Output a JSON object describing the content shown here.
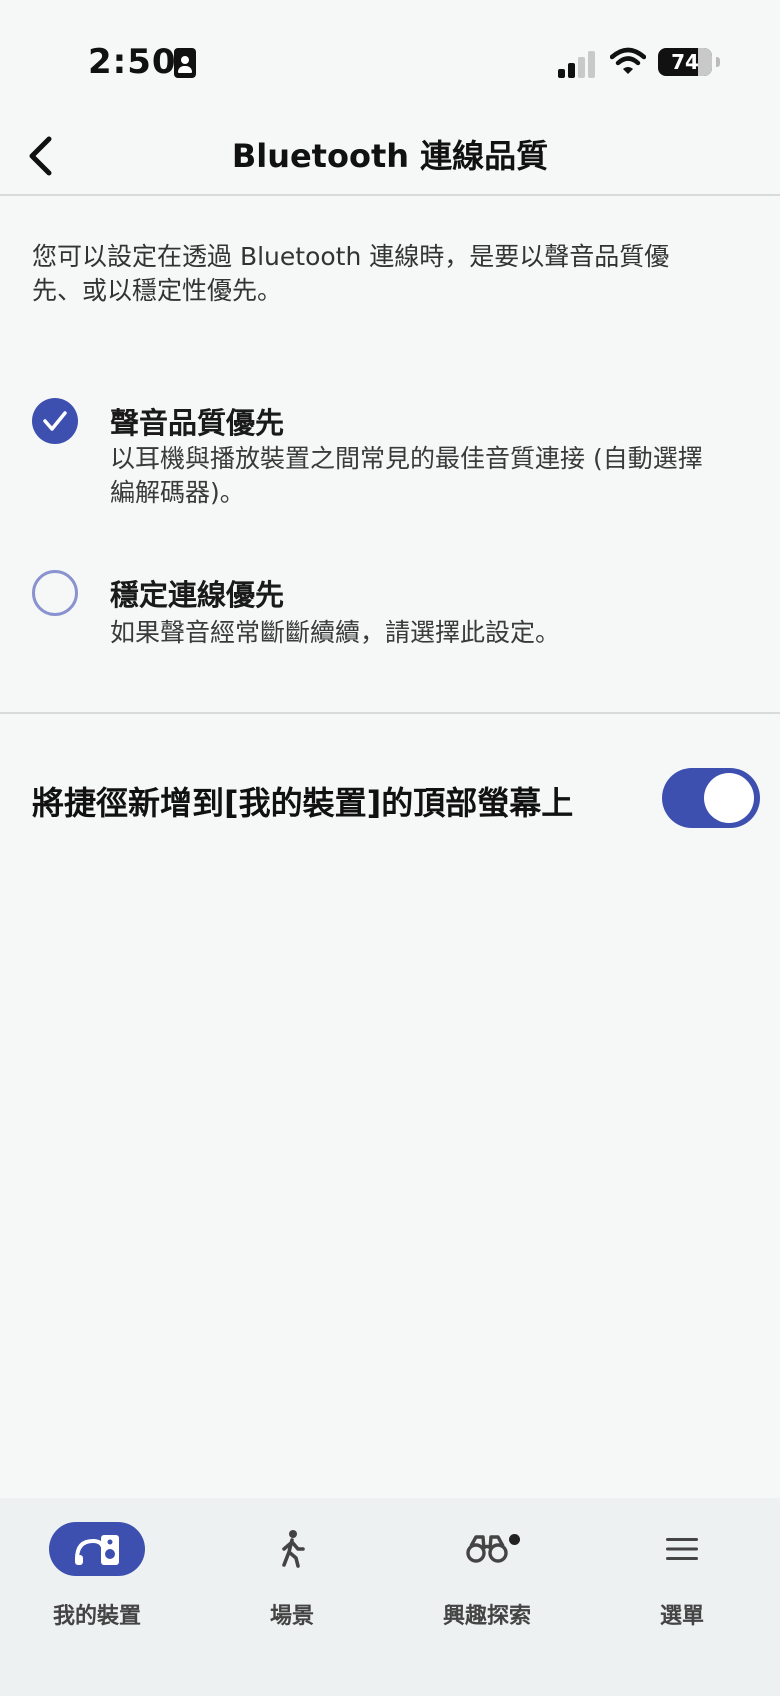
{
  "status_bar": {
    "time": "2:50",
    "battery_level": "74"
  },
  "nav": {
    "title": "Bluetooth 連線品質"
  },
  "description": "您可以設定在透過 Bluetooth 連線時，是要以聲音品質優先、或以穩定性優先。",
  "options": [
    {
      "title": "聲音品質優先",
      "desc": "以耳機與播放裝置之間常見的最佳音質連接 (自動選擇編解碼器)。",
      "selected": true
    },
    {
      "title": "穩定連線優先",
      "desc": "如果聲音經常斷斷續續，請選擇此設定。",
      "selected": false
    }
  ],
  "shortcut": {
    "label": "將捷徑新增到[我的裝置]的頂部螢幕上",
    "enabled": true
  },
  "tabs": [
    {
      "label": "我的裝置",
      "icon": "headphones-speaker-icon",
      "active": true
    },
    {
      "label": "場景",
      "icon": "walking-person-icon",
      "active": false
    },
    {
      "label": "興趣探索",
      "icon": "binoculars-icon",
      "active": false,
      "badge": true
    },
    {
      "label": "選單",
      "icon": "menu-icon",
      "active": false
    }
  ],
  "colors": {
    "accent": "#3d50b0",
    "background": "#f6f8f8",
    "tab_bar": "#eef1f2"
  }
}
